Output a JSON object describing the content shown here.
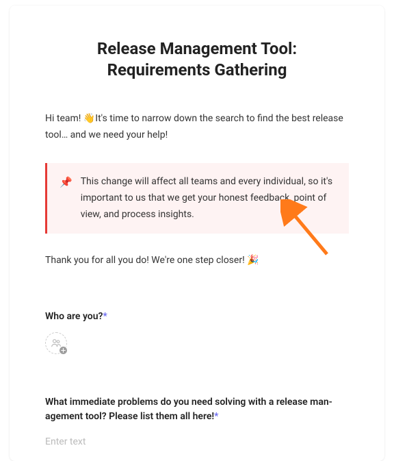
{
  "title": "Release Management Tool: Requirements Gathering",
  "intro_prefix": "Hi team! ",
  "intro_emoji": "👋",
  "intro_suffix": "It's time to narrow down the search to find the best release tool… and we need your help!",
  "callout": {
    "icon": "📌",
    "text": "This change will affect all teams and every individual, so it's important to us that we get your honest feedback, point of view, and process insights."
  },
  "thanks_prefix": "Thank you for all you do! We're one step closer! ",
  "thanks_emoji": "🎉",
  "q1": {
    "label": "Who are you?",
    "required_mark": "*"
  },
  "q2": {
    "label": "What immediate problems do you need solving with a release man­agement tool? Please list them all here!",
    "required_mark": "*",
    "placeholder": "Enter text"
  }
}
